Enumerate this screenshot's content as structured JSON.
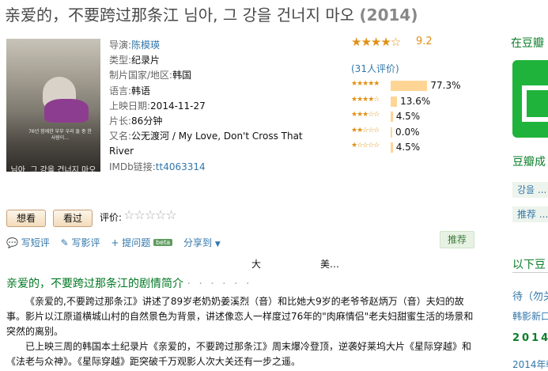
{
  "title": {
    "text": "亲爱的，不要跨过那条江 님아, 그 강을 건너지 마오",
    "year": "(2014)"
  },
  "poster": {
    "small_text": "76년 함께한 부부 우리 둘 중 한 사람이…",
    "poster_title": "님아, 그 강을 건너지 마오"
  },
  "info": {
    "director_label": "导演:",
    "director": "陈模瑛",
    "genre_label": "类型:",
    "genre": "纪录片",
    "country_label": "制片国家/地区:",
    "country": "韩国",
    "language_label": "语言:",
    "language": "韩语",
    "release_label": "上映日期:",
    "release": "2014-11-27",
    "runtime_label": "片长:",
    "runtime": "86分钟",
    "aka_label": "又名:",
    "aka": "公无渡河 / My Love, Don't Cross That River",
    "imdb_label": "IMDb链接:",
    "imdb": "tt4063314"
  },
  "rating": {
    "score": "9.2",
    "stars_main": "★★★★☆",
    "votes": "(31人评价)",
    "breakdown": [
      {
        "stars": "★★★★★",
        "pct_text": "77.3%",
        "pct": 77.3
      },
      {
        "stars": "★★★★☆",
        "pct_text": "13.6%",
        "pct": 13.6
      },
      {
        "stars": "★★★☆☆",
        "pct_text": "4.5%",
        "pct": 4.5
      },
      {
        "stars": "★★☆☆☆",
        "pct_text": "0.0%",
        "pct": 0.0
      },
      {
        "stars": "★☆☆☆☆",
        "pct_text": "4.5%",
        "pct": 4.5
      }
    ]
  },
  "buttons": {
    "want": "想看",
    "seen": "看过"
  },
  "rate": {
    "label": "评价:",
    "stars": "☆☆☆☆☆"
  },
  "actions": {
    "short_review": "写短评",
    "review": "写影评",
    "question": "提问题",
    "beta": "beta",
    "share": "分享到",
    "recommend": "推荐"
  },
  "noise": {
    "a": "大",
    "b": "美…"
  },
  "summary": {
    "title": "亲爱的，不要跨过那条江的剧情简介",
    "dots": "· · · · · ·",
    "p1": "《亲爱的,不要跨过那条江》讲述了89岁老奶奶姜溪烈（音）和比她大9岁的老爷爷赵炳万（音）夫妇的故事。影片以江原道横城山村的自然景色为背景，讲述像恋人一样度过76年的\"肉麻情侣\"老夫妇甜蜜生活的场景和突然的离别。",
    "p2": "已上映三周的韩国本土纪录片《亲爱的，不要跨过那条江》周末爆冷登顶，逆袭好莱坞大片《星际穿越》和《法老与众神》。《星际穿越》距突破千万观影人次大关还有一步之遥。"
  },
  "sidebar": {
    "where_to_watch": "在豆瓣",
    "douban_title": "豆瓣成",
    "tag1": "강을 ...",
    "tag2": "推荐 ...",
    "below": "以下豆",
    "link1": "待（勿关",
    "link2": "韩影新口",
    "year_bold": "2014",
    "link3": "2014年韩"
  },
  "colors": {
    "accent_green": "#007722",
    "link": "#3377aa",
    "star": "#e09015",
    "bar": "#ffd596"
  }
}
